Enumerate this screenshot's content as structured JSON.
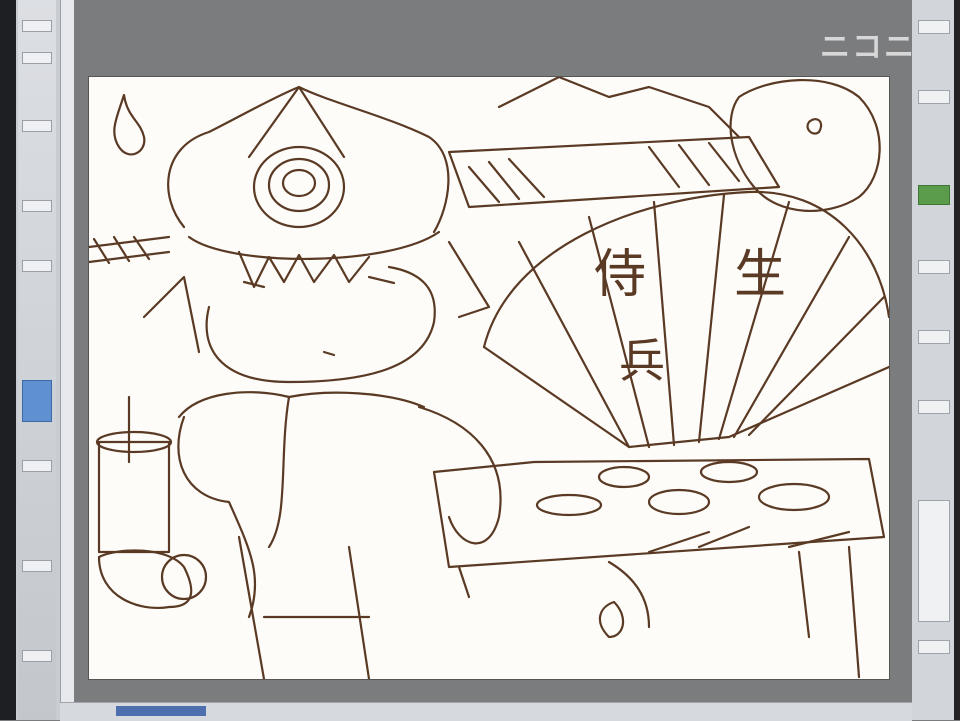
{
  "watermark": {
    "text": "ニコニ"
  },
  "fan": {
    "char1": "侍",
    "char2": "生",
    "char3": "兵"
  },
  "icons": [
    "pen-tool-icon",
    "brush-tool-icon",
    "eraser-icon",
    "layer-icon",
    "color-swatch-icon"
  ]
}
